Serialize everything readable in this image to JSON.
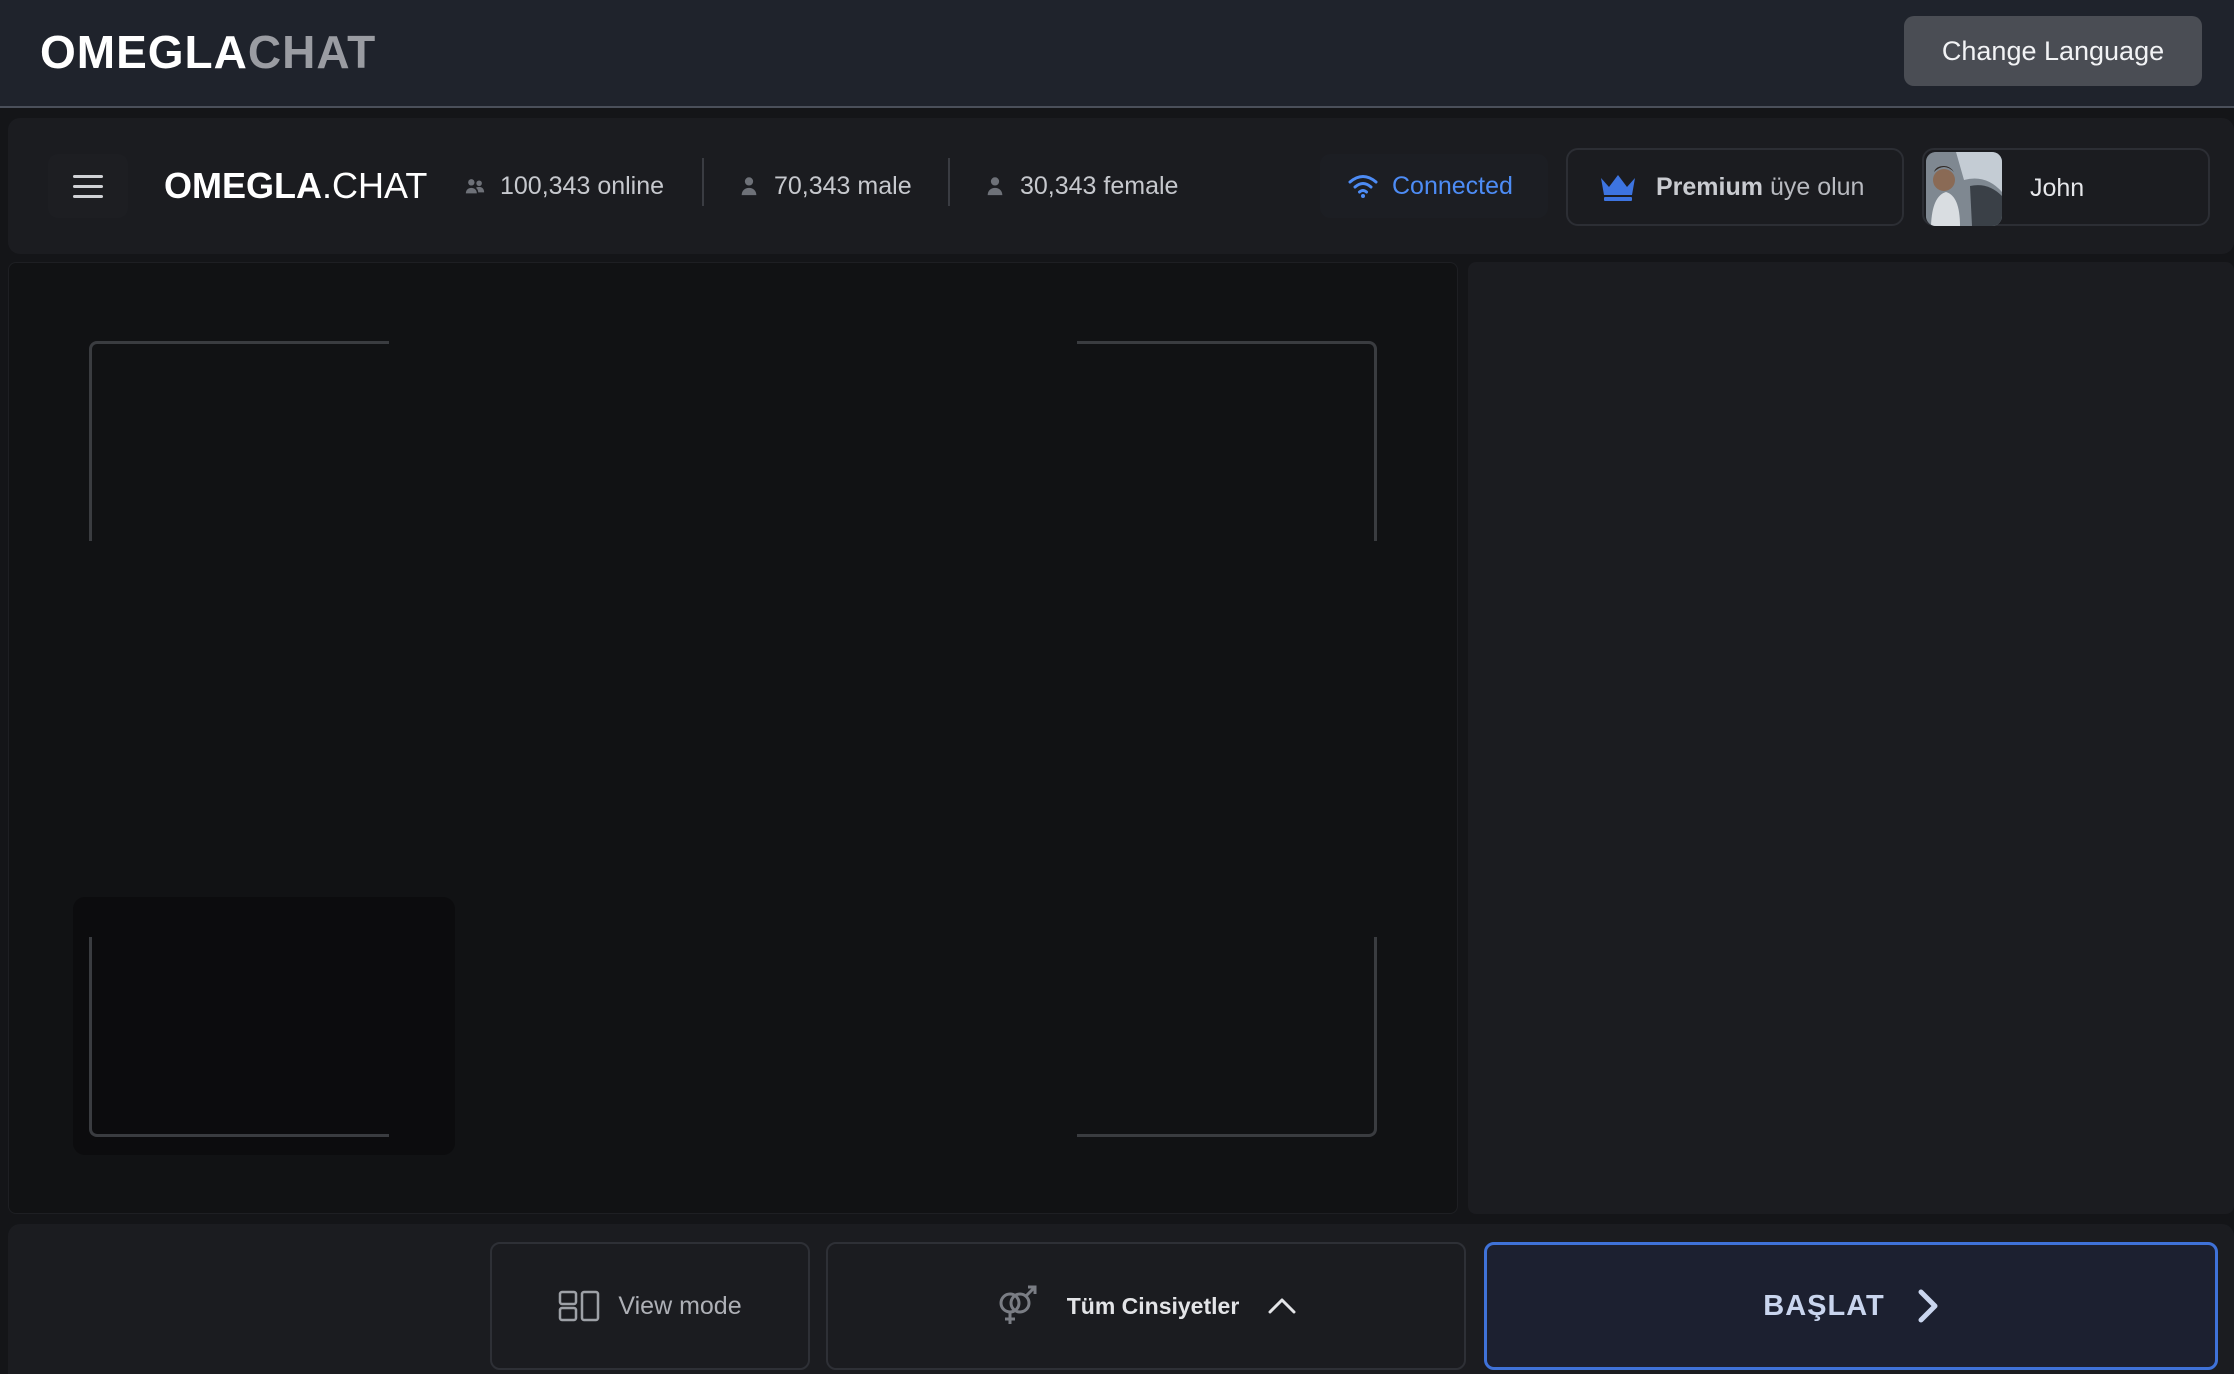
{
  "header": {
    "logo_main": "OMEGLA",
    "logo_accent": "CHAT",
    "change_language_label": "Change Language"
  },
  "appbar": {
    "logo_bold": "OMEGLA",
    "logo_thin": ".CHAT",
    "stats": {
      "online": "100,343 online",
      "male": "70,343 male",
      "female": "30,343 female"
    },
    "connection_status": "Connected",
    "premium_bold": "Premium",
    "premium_rest": "üye olun",
    "user_name": "John"
  },
  "controls": {
    "view_mode_label": "View mode",
    "gender_filter_label": "Tüm Cinsiyetler",
    "start_label": "BAŞLAT"
  },
  "colors": {
    "accent_blue": "#4d8cf5",
    "start_border": "#3f72d8",
    "header_bg": "#1f232c",
    "panel_bg": "#1b1c20"
  },
  "icons": {
    "menu": "hamburger-icon",
    "online": "users-icon",
    "male": "user-icon",
    "female": "user-icon",
    "connection": "wifi-icon",
    "premium": "crown-icon",
    "view_mode": "layout-icon",
    "gender": "gender-symbol-icon",
    "gender_toggle": "chevron-up-icon",
    "start": "chevron-right-icon"
  }
}
